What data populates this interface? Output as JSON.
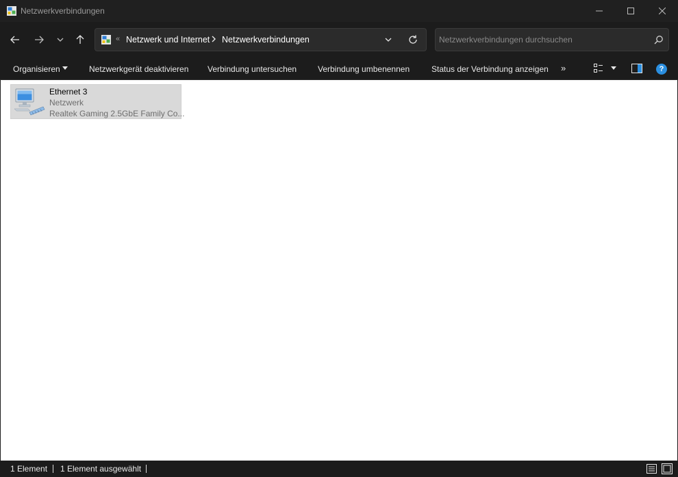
{
  "window": {
    "title": "Netzwerkverbindungen",
    "controls": {
      "minimize": "minimize-icon",
      "maximize": "maximize-icon",
      "close": "close-icon"
    }
  },
  "navigation": {
    "icons": [
      "back-arrow-icon",
      "forward-arrow-icon",
      "chevron-down-icon",
      "up-arrow-icon"
    ]
  },
  "address_bar": {
    "overflow": "«",
    "breadcrumbs": [
      "Netzwerk und Internet",
      "Netzwerkverbindungen"
    ]
  },
  "search": {
    "placeholder": "Netzwerkverbindungen durchsuchen",
    "value": ""
  },
  "commands": {
    "organize": "Organisieren",
    "disable": "Netzwerkgerät deaktivieren",
    "diagnose": "Verbindung untersuchen",
    "rename": "Verbindung umbenennen",
    "status": "Status der Verbindung anzeigen",
    "more": "»",
    "help": "?"
  },
  "items": [
    {
      "name": "Ethernet 3",
      "status": "Netzwerk",
      "device": "Realtek Gaming 2.5GbE Family Co..."
    }
  ],
  "status_bar": {
    "count": "1 Element",
    "selected": "1 Element ausgewählt"
  },
  "colors": {
    "chrome_bg": "#1c1c1c",
    "content_bg": "#ffffff",
    "selection_bg": "#d9d9d9",
    "accent": "#2b8fe0"
  }
}
